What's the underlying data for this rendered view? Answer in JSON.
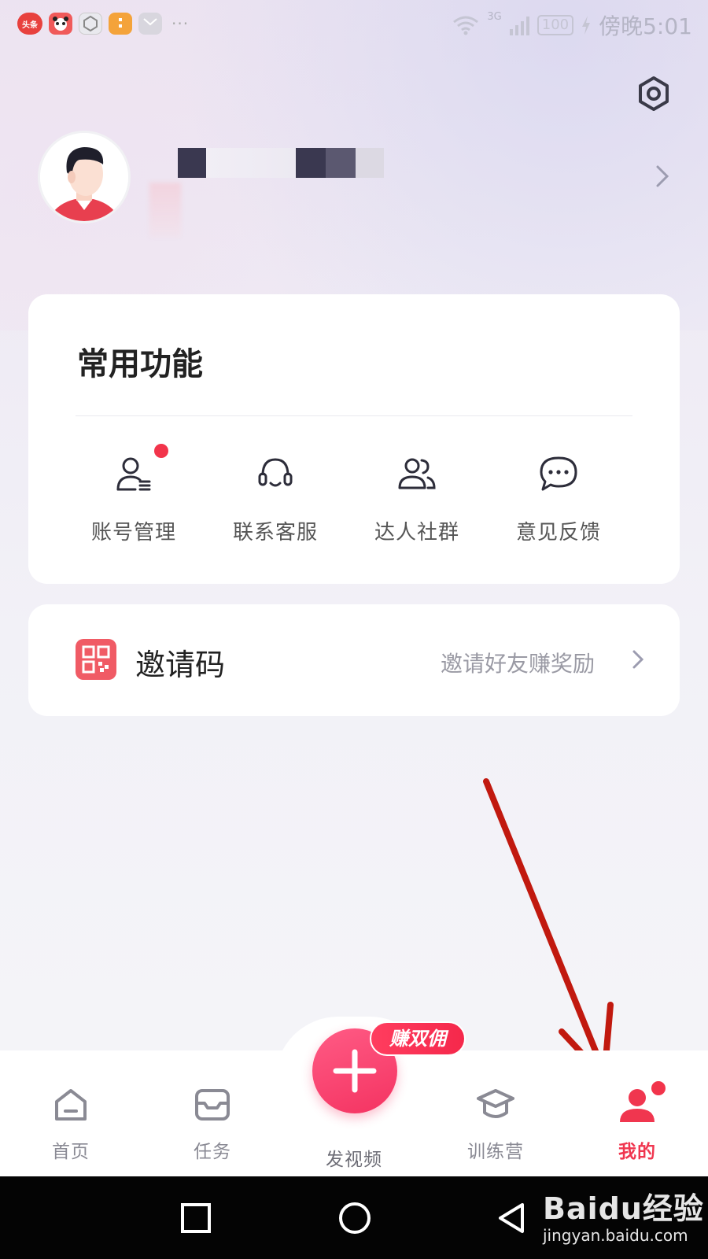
{
  "status_bar": {
    "notification_apps": [
      "头条",
      "熊猫",
      "灵",
      "橙",
      "信"
    ],
    "more": "···",
    "network": "3G",
    "battery": "100",
    "time": "傍晚5:01"
  },
  "functions": {
    "title": "常用功能",
    "items": [
      {
        "label": "账号管理",
        "icon": "account-manage-icon",
        "badge": true
      },
      {
        "label": "联系客服",
        "icon": "headset-icon",
        "badge": false
      },
      {
        "label": "达人社群",
        "icon": "group-icon",
        "badge": false
      },
      {
        "label": "意见反馈",
        "icon": "chat-bubble-icon",
        "badge": false
      }
    ]
  },
  "invite": {
    "title": "邀请码",
    "hint": "邀请好友赚奖励"
  },
  "tab_bar": {
    "tabs": [
      {
        "label": "首页",
        "icon": "home-icon"
      },
      {
        "label": "任务",
        "icon": "task-icon"
      },
      {
        "label": "发视频",
        "icon": "plus-icon"
      },
      {
        "label": "训练营",
        "icon": "graduation-cap-icon"
      },
      {
        "label": "我的",
        "icon": "profile-icon"
      }
    ],
    "active_tab": "我的",
    "fab_badge": "赚双佣"
  },
  "watermark": {
    "brand": "Baidu经验",
    "url": "jingyan.baidu.com"
  },
  "colors": {
    "accent": "#f0364f",
    "fab": "#f43361",
    "invite_icon": "#f05b65",
    "annotation_arrow": "#c1190f"
  }
}
